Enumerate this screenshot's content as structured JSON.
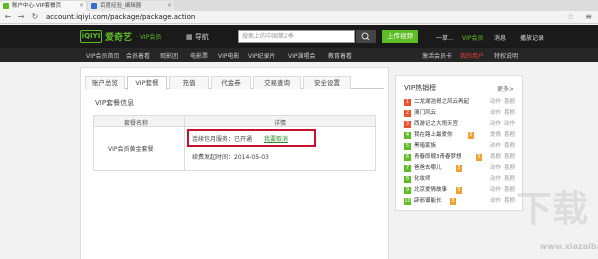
{
  "browser": {
    "tabs": [
      {
        "label": "账户中心-VIP套餐页",
        "active": true
      },
      {
        "label": "百度经验_编辑器",
        "active": false
      }
    ],
    "url": "account.iqiyi.com/package/package.action"
  },
  "header": {
    "logo_mark": "iQIYI",
    "logo_name": "爱奇艺",
    "logo_vip": "· VIP会员",
    "guide": "导航",
    "search_placeholder": "搜索上的中国第2季",
    "upload_label": "上传视频",
    "links": [
      "一草...",
      "VIP会员",
      "消息",
      "播放记录"
    ]
  },
  "subnav": {
    "items": [
      "VIP会员首页",
      "会员着看",
      "观影团",
      "电影票",
      "VIP电影",
      "VIP纪录片",
      "VIP演唱会",
      "教育着看"
    ],
    "right_items": [
      "激活会员卡",
      "我的用户",
      "特权说明"
    ]
  },
  "main": {
    "tabs": [
      "账户总览",
      "VIP套餐",
      "充值",
      "代金券",
      "交易查询",
      "安全设置"
    ],
    "section_title": "VIP套餐信息",
    "table": {
      "col_name": "套餐名称",
      "col_detail": "详情",
      "package_name": "VIP会员黄金套餐",
      "status_prefix": "连续包月服务：已开通",
      "cancel_link": "我要取消",
      "next_date": "续费发起时间：2014-05-03"
    }
  },
  "sidebar": {
    "title": "VIP热销榜",
    "more": "更多>",
    "items": [
      {
        "rank": "1",
        "title": "二龙湖浩哥之风云再起",
        "act": "动作",
        "genre": "喜剧"
      },
      {
        "rank": "2",
        "title": "澳门风云",
        "act": "动作",
        "genre": "喜剧"
      },
      {
        "rank": "3",
        "title": "西游记之大闹天宫",
        "act": "动作",
        "genre": "动作"
      },
      {
        "rank": "4",
        "title": "我在路上最爱你",
        "act": "爱情",
        "genre": "喜剧"
      },
      {
        "rank": "5",
        "title": "黑暗家族",
        "act": "动作",
        "genre": "喜剧"
      },
      {
        "rank": "6",
        "title": "青春即顺3青春梦想",
        "act": "喜剧",
        "genre": "喜剧"
      },
      {
        "rank": "7",
        "title": "爸爸去哪儿",
        "act": "动作",
        "genre": "喜剧"
      },
      {
        "rank": "8",
        "title": "化妆师",
        "act": "动作",
        "genre": "喜剧"
      },
      {
        "rank": "9",
        "title": "北京爱情故事",
        "act": "动作",
        "genre": "喜剧"
      },
      {
        "rank": "10",
        "title": "辟邪谱能长",
        "act": "动作",
        "genre": "喜剧"
      }
    ]
  },
  "watermark": {
    "mark": "下载",
    "site": "www.xiazaiba.com"
  },
  "colors": {
    "brand": "#5ebd24",
    "highlight": "#c8102e",
    "link_green": "#2a8f2a"
  }
}
